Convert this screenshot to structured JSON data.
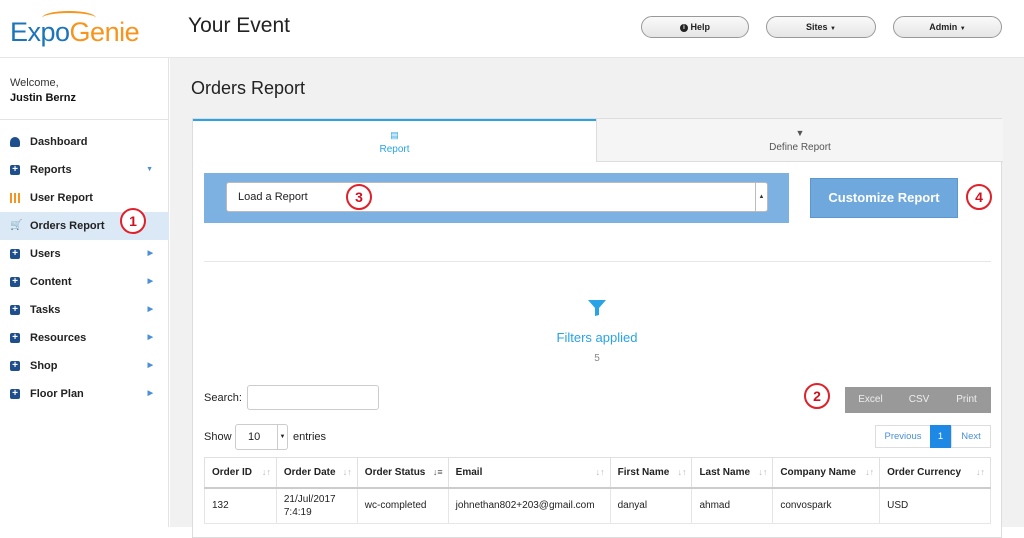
{
  "header": {
    "logo_part1": "Expo",
    "logo_part2": "Genie",
    "event_title": "Your Event",
    "help_label": "Help",
    "sites_label": "Sites",
    "admin_label": "Admin"
  },
  "sidebar": {
    "welcome": "Welcome,",
    "user_name": "Justin Bernz",
    "items": [
      {
        "label": "Dashboard",
        "icon": "dashboard-icon"
      },
      {
        "label": "Reports",
        "icon": "plus-icon"
      },
      {
        "label": "User Report",
        "icon": "grid-icon"
      },
      {
        "label": "Orders Report",
        "icon": "cart-icon"
      },
      {
        "label": "Users",
        "icon": "plus-icon"
      },
      {
        "label": "Content",
        "icon": "plus-icon"
      },
      {
        "label": "Tasks",
        "icon": "plus-icon"
      },
      {
        "label": "Resources",
        "icon": "plus-icon"
      },
      {
        "label": "Shop",
        "icon": "plus-icon"
      },
      {
        "label": "Floor Plan",
        "icon": "plus-icon"
      }
    ]
  },
  "main": {
    "page_title": "Orders Report",
    "tabs": [
      {
        "label": "Report"
      },
      {
        "label": "Define Report"
      }
    ],
    "load_report_placeholder": "Load a Report",
    "customize_label": "Customize Report",
    "filters_label": "Filters applied",
    "filters_count": "5",
    "search_label": "Search:",
    "export_buttons": [
      "Excel",
      "CSV",
      "Print"
    ],
    "show_label": "Show",
    "entries_value": "10",
    "entries_label": "entries",
    "pagination": {
      "previous": "Previous",
      "current": "1",
      "next": "Next"
    },
    "table": {
      "columns": [
        "Order ID",
        "Order Date",
        "Order Status",
        "Email",
        "First Name",
        "Last Name",
        "Company Name",
        "Order Currency"
      ],
      "rows": [
        [
          "132",
          "21/Jul/2017 7:4:19",
          "wc-completed",
          "johnethan802+203@gmail.com",
          "danyal",
          "ahmad",
          "convospark",
          "USD"
        ]
      ]
    }
  },
  "annotations": [
    "1",
    "2",
    "3",
    "4"
  ],
  "colors": {
    "accent": "#29a3e6",
    "brand_blue": "#1b75bb",
    "brand_orange": "#f7941d",
    "badge_red": "#e0202a"
  }
}
